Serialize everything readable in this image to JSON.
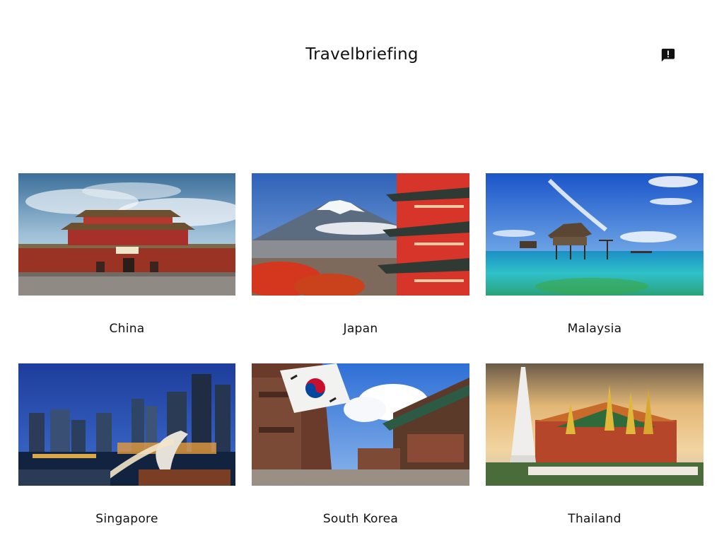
{
  "app": {
    "title": "Travelbriefing",
    "feedback_icon": "feedback-icon"
  },
  "countries": [
    {
      "name": "China",
      "image": "forbidden-city-gate"
    },
    {
      "name": "Japan",
      "image": "mount-fuji-pagoda"
    },
    {
      "name": "Malaysia",
      "image": "stilt-house-sea"
    },
    {
      "name": "Singapore",
      "image": "marina-bay-merlion-night"
    },
    {
      "name": "South Korea",
      "image": "korean-flag-hanok-street"
    },
    {
      "name": "Thailand",
      "image": "grand-palace-temple"
    }
  ]
}
